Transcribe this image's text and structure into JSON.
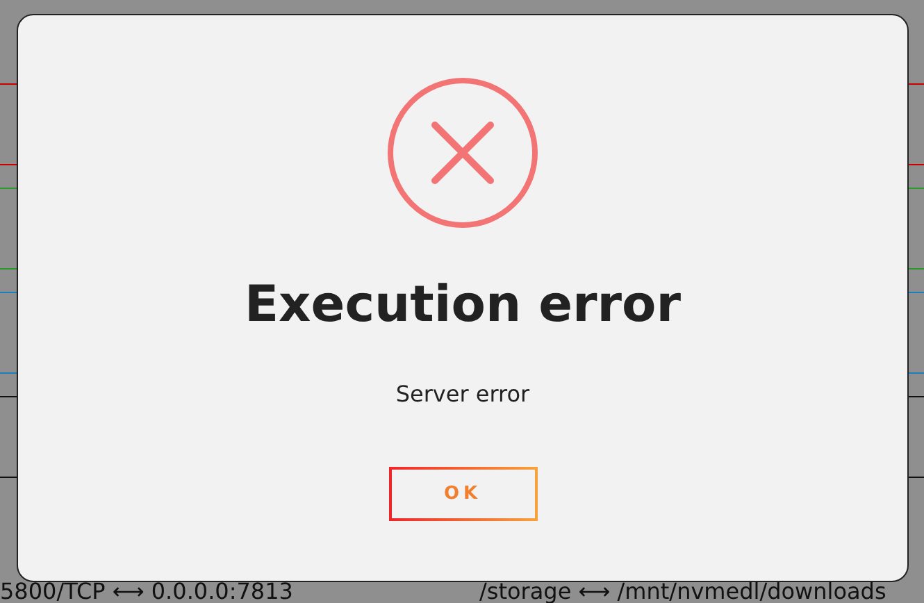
{
  "background": {
    "mappings": [
      "5800/TCP ⟷ 0.0.0.0:7813",
      "/storage ⟷ /mnt/nvmedl/downloads"
    ]
  },
  "dialog": {
    "kind": "error",
    "title": "Execution error",
    "message": "Server error",
    "button": "OK"
  }
}
